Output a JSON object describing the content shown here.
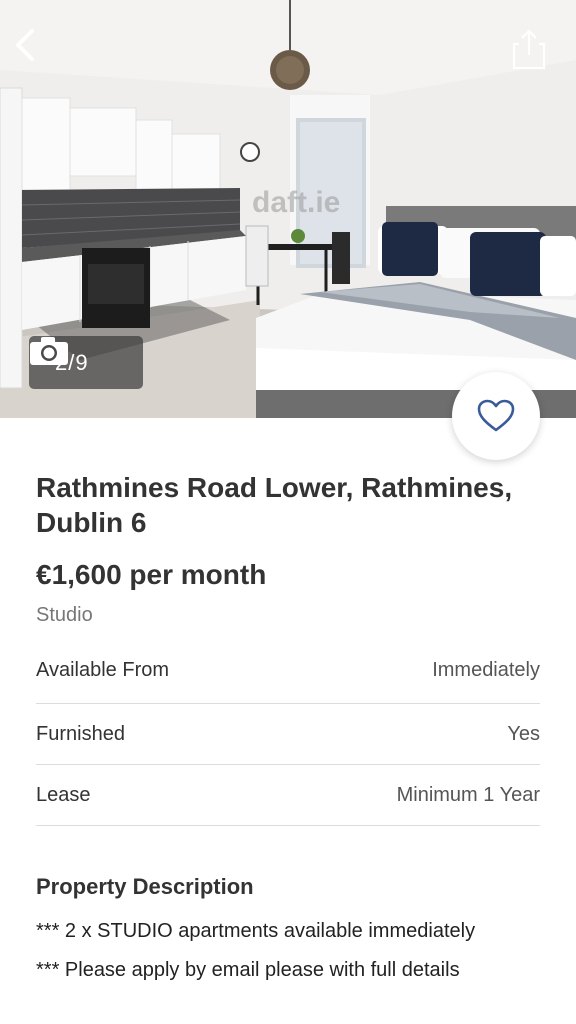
{
  "hero": {
    "photo_counter": "2/9",
    "watermark": "daft.ie"
  },
  "listing": {
    "address": "Rathmines Road Lower, Rathmines, Dublin 6",
    "price": "€1,600 per month",
    "property_type": "Studio"
  },
  "details": [
    {
      "label": "Available From",
      "value": "Immediately"
    },
    {
      "label": "Furnished",
      "value": "Yes"
    },
    {
      "label": "Lease",
      "value": "Minimum 1 Year"
    }
  ],
  "description": {
    "heading": "Property Description",
    "lines": [
      "*** 2 x STUDIO apartments available immediately",
      "*** Please apply by email please with full details"
    ]
  },
  "colors": {
    "heart": "#3a5a9a",
    "text": "#333333",
    "muted": "#777777",
    "divider": "#dcdcdc"
  },
  "icons": [
    "back-arrow-icon",
    "share-icon",
    "camera-icon",
    "heart-icon"
  ]
}
